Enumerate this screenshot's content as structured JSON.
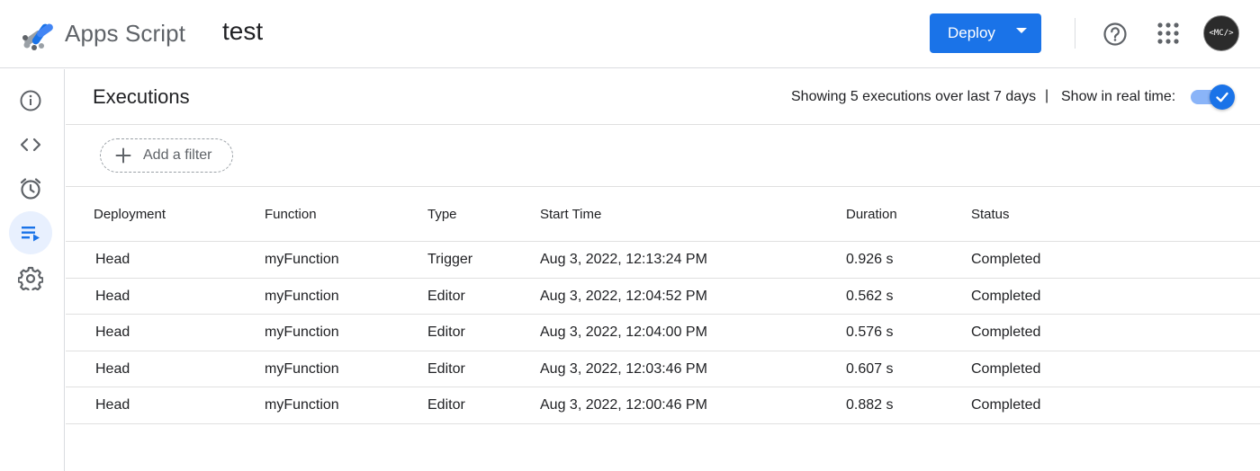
{
  "header": {
    "app_name": "Apps Script",
    "project_name": "test",
    "deploy_label": "Deploy",
    "avatar_text": "<MC/>",
    "accent_color": "#1a73e8"
  },
  "rail": {
    "items": [
      {
        "icon": "info-icon",
        "label": "Overview"
      },
      {
        "icon": "code-icon",
        "label": "Editor"
      },
      {
        "icon": "alarm-icon",
        "label": "Triggers"
      },
      {
        "icon": "executions-icon",
        "label": "Executions",
        "active": true
      },
      {
        "icon": "gear-icon",
        "label": "Project Settings"
      }
    ]
  },
  "page": {
    "title": "Executions",
    "summary": "Showing 5 executions over last 7 days",
    "separator": "|",
    "realtime_label": "Show in real time:",
    "realtime_on": true,
    "add_filter_label": "Add a filter"
  },
  "table": {
    "columns": [
      "Deployment",
      "Function",
      "Type",
      "Start Time",
      "Duration",
      "Status"
    ],
    "rows": [
      [
        "Head",
        "myFunction",
        "Trigger",
        "Aug 3, 2022, 12:13:24 PM",
        "0.926 s",
        "Completed"
      ],
      [
        "Head",
        "myFunction",
        "Editor",
        "Aug 3, 2022, 12:04:52 PM",
        "0.562 s",
        "Completed"
      ],
      [
        "Head",
        "myFunction",
        "Editor",
        "Aug 3, 2022, 12:04:00 PM",
        "0.576 s",
        "Completed"
      ],
      [
        "Head",
        "myFunction",
        "Editor",
        "Aug 3, 2022, 12:03:46 PM",
        "0.607 s",
        "Completed"
      ],
      [
        "Head",
        "myFunction",
        "Editor",
        "Aug 3, 2022, 12:00:46 PM",
        "0.882 s",
        "Completed"
      ]
    ]
  }
}
